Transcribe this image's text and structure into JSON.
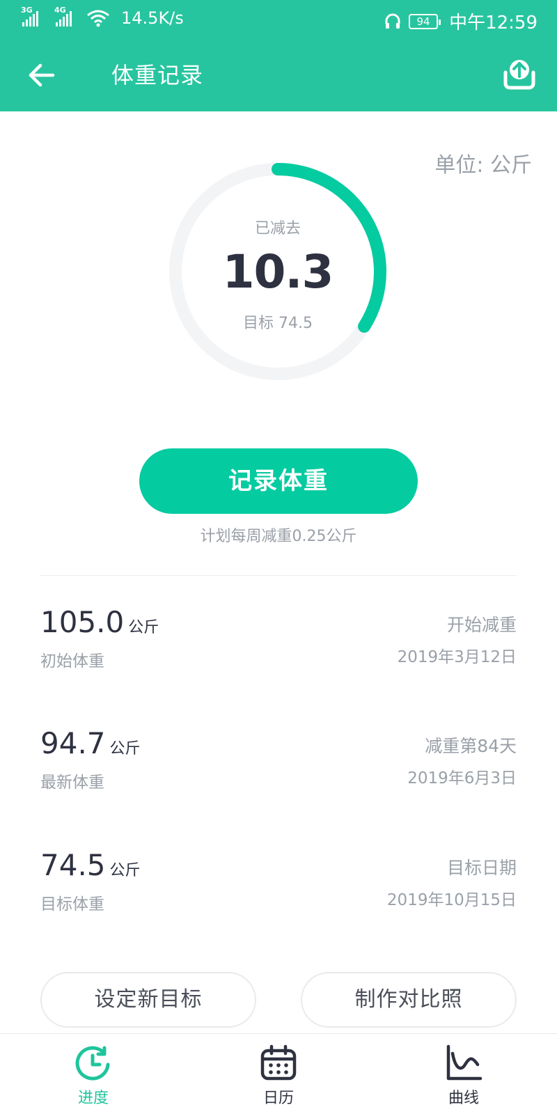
{
  "status_bar": {
    "net1": "3G",
    "net2": "4G",
    "speed": "14.5K/s",
    "battery": "94",
    "time": "中午12:59"
  },
  "app_bar": {
    "title": "体重记录",
    "back_icon": "arrow-left-icon",
    "share_icon": "upload-icon"
  },
  "unit": "单位: 公斤",
  "progress": {
    "caption": "已减去",
    "value": "10.3",
    "goal": "目标 74.5",
    "fraction": 0.34
  },
  "record_button": "记录体重",
  "plan": "计划每周减重0.25公斤",
  "stats": [
    {
      "value": "105.0",
      "unit": "公斤",
      "label": "初始体重",
      "right_top": "开始减重",
      "right_bottom": "2019年3月12日"
    },
    {
      "value": "94.7",
      "unit": "公斤",
      "label": "最新体重",
      "right_top": "减重第84天",
      "right_bottom": "2019年6月3日"
    },
    {
      "value": "74.5",
      "unit": "公斤",
      "label": "目标体重",
      "right_top": "目标日期",
      "right_bottom": "2019年10月15日"
    }
  ],
  "buttons": {
    "new_goal": "设定新目标",
    "compare": "制作对比照"
  },
  "tabs": [
    {
      "label": "进度",
      "icon": "clock-refresh-icon",
      "active": true
    },
    {
      "label": "日历",
      "icon": "calendar-icon",
      "active": false
    },
    {
      "label": "曲线",
      "icon": "line-chart-icon",
      "active": false
    }
  ],
  "colors": {
    "brand": "#27c59f",
    "accent": "#05cba0",
    "ring_track": "#f3f4f6",
    "text_dark": "#2e3140",
    "text_muted": "#9aa0a8"
  }
}
